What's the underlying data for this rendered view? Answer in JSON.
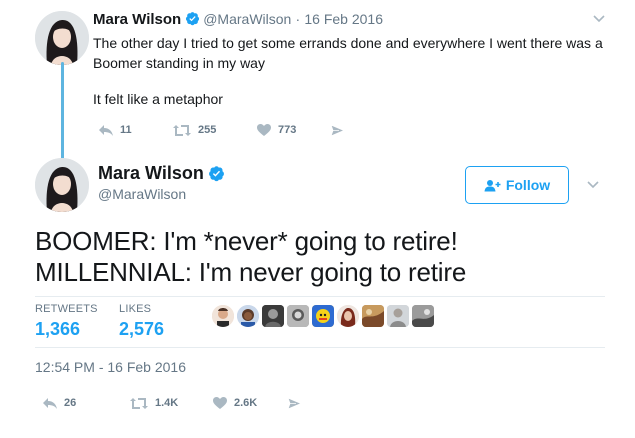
{
  "reply_tweet": {
    "name": "Mara Wilson",
    "handle": "@MaraWilson",
    "separator": "·",
    "date": "16 Feb 2016",
    "text_lines": [
      "The other day I tried to get some errands done and everywhere I went there was a Boomer standing in my way",
      "It felt like a metaphor"
    ],
    "reply_count": "11",
    "retweet_count": "255",
    "like_count": "773"
  },
  "main_tweet": {
    "name": "Mara Wilson",
    "handle": "@MaraWilson",
    "follow_label": "Follow",
    "text_lines": [
      "BOOMER: I'm *never* going to retire!",
      "MILLENNIAL: I'm never going to retire"
    ],
    "retweets_label": "RETWEETS",
    "retweets_value": "1,366",
    "likes_label": "LIKES",
    "likes_value": "2,576",
    "timestamp": "12:54 PM - 16 Feb 2016",
    "reply_count": "26",
    "retweet_count": "1.4K",
    "like_count": "2.6K"
  },
  "icons": {
    "verified": "verified-badge-icon",
    "reply": "reply-icon",
    "retweet": "retweet-icon",
    "like": "heart-icon",
    "dm": "direct-message-icon",
    "caret": "chevron-down-icon",
    "follow": "add-user-icon"
  },
  "colors": {
    "accent": "#1da1f2",
    "thread": "#5eb5e0",
    "muted": "#657786",
    "text": "#14171a"
  }
}
